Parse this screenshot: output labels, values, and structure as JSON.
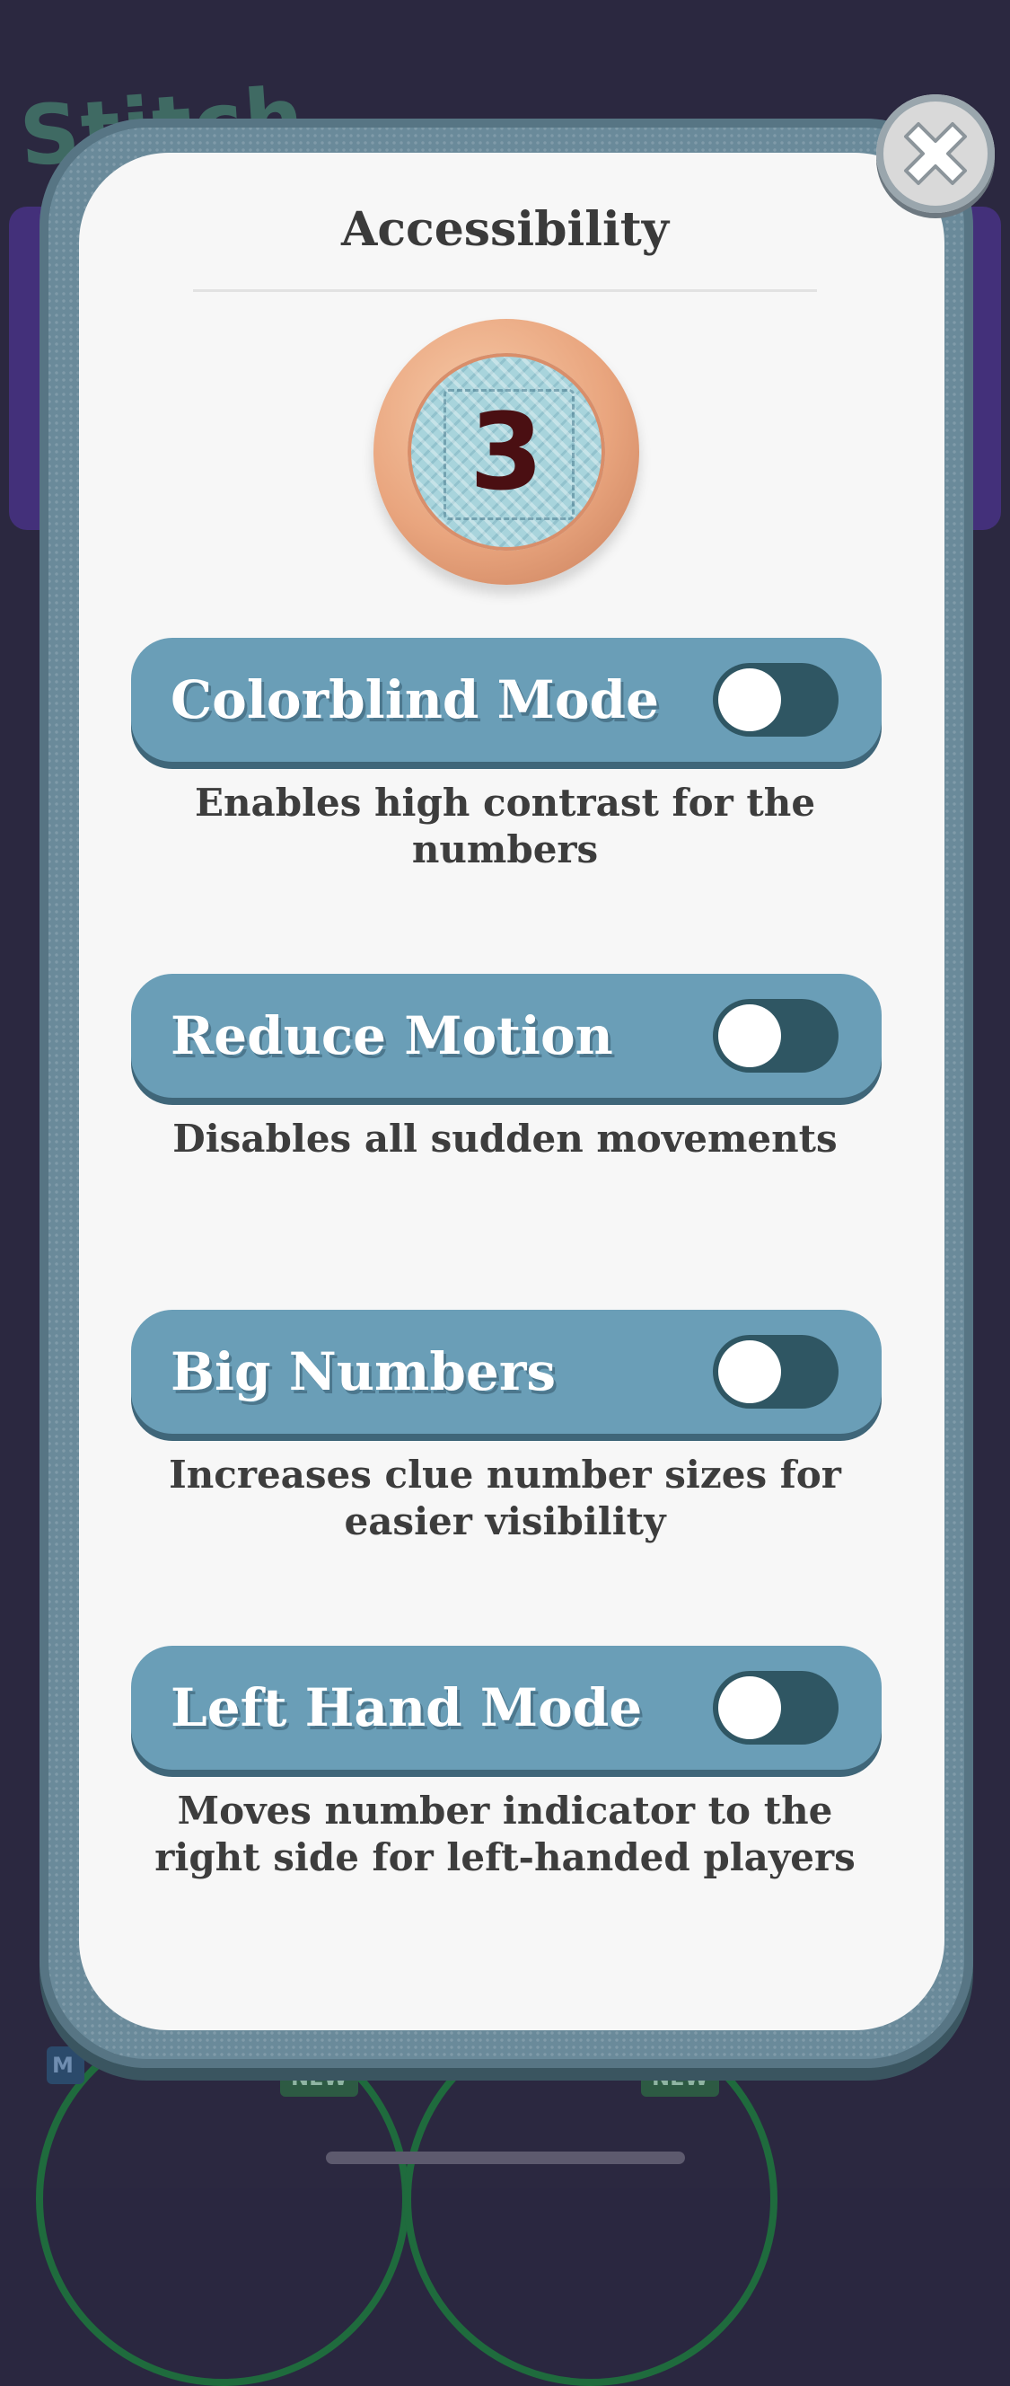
{
  "background": {
    "logo_text": "Stitch",
    "badges": {
      "m": "M",
      "new_1": "NEW",
      "new_2": "NEW"
    }
  },
  "modal": {
    "title": "Accessibility",
    "close_icon": "close-x-icon",
    "level_value": "3"
  },
  "settings": [
    {
      "label": "Colorblind Mode",
      "description": "Enables high contrast for the numbers",
      "enabled": false
    },
    {
      "label": "Reduce Motion",
      "description": "Disables all sudden movements",
      "enabled": false
    },
    {
      "label": "Big Numbers",
      "description": "Increases clue number sizes for easier visibility",
      "enabled": false
    },
    {
      "label": "Left Hand Mode",
      "description": "Moves number indicator to the right side for left-handed players",
      "enabled": false
    }
  ],
  "colors": {
    "row_bg": "#6a9eb7",
    "toggle_track": "#2f5663",
    "card_bg": "#f7f7f7"
  }
}
